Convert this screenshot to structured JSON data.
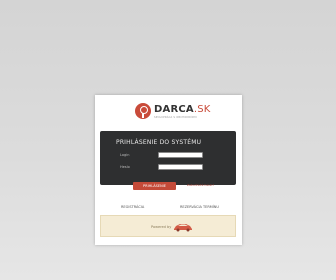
{
  "brand": {
    "name": "DARCA",
    "tld": ".SK",
    "tagline": "SPOLUPRÁCA S OBCHODNÍKMI"
  },
  "login": {
    "title": "PRIHLÁSENIE DO SYSTÉMU",
    "login_label": "Login",
    "password_label": "Heslo",
    "login_value": "",
    "password_value": "",
    "submit_label": "PRIHLÁSENIE",
    "forgot_label": "Zabudnuté heslo?"
  },
  "links": {
    "registration": "REGISTRÁCIA",
    "reservation": "REZERVÁCIA TERMÍNU"
  },
  "footer": {
    "text": "Powered by",
    "logo_icon": "car-icon"
  },
  "colors": {
    "accent": "#c94b3a",
    "panel": "#2e2f30",
    "footer_bg": "#f5ecd5"
  }
}
